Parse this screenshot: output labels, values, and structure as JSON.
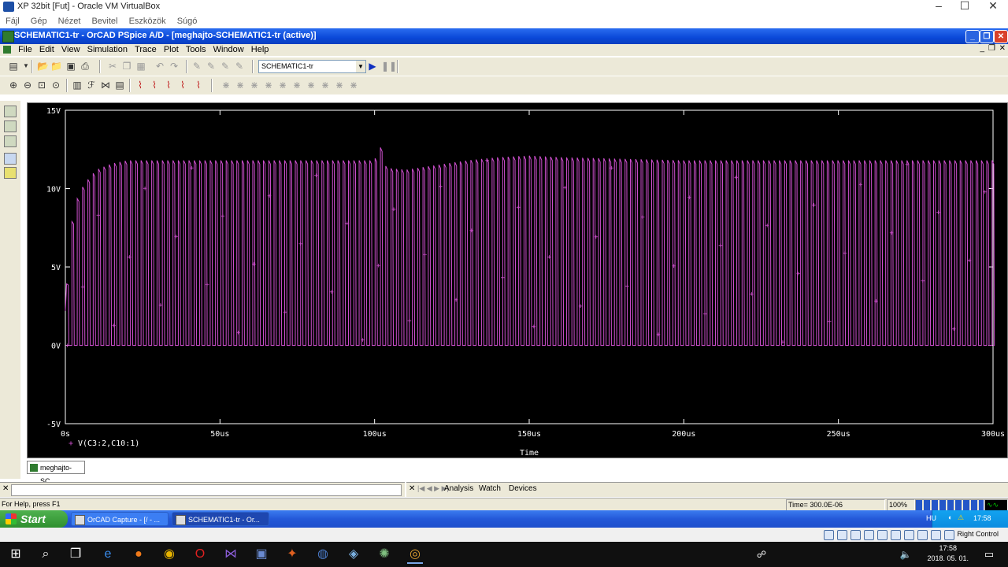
{
  "vbox": {
    "title": "XP 32bit [Fut] - Oracle VM VirtualBox",
    "menu": [
      "Fájl",
      "Gép",
      "Nézet",
      "Bevitel",
      "Eszközök",
      "Súgó"
    ],
    "minimize": "–",
    "maximize": "☐",
    "close": "✕",
    "status_right": "Right Control"
  },
  "app": {
    "title": "SCHEMATIC1-tr - OrCAD PSpice A/D - [meghajto-SCHEMATIC1-tr (active)]",
    "menu": [
      "File",
      "Edit",
      "View",
      "Simulation",
      "Trace",
      "Plot",
      "Tools",
      "Window",
      "Help"
    ],
    "sim_profile": "SCHEMATIC1-tr",
    "doc_tab": "meghajto-SC..."
  },
  "toolbar_icons": {
    "row1": [
      "new-icon",
      "open-icon",
      "open-folder-icon",
      "save-icon",
      "print-icon",
      "cut-icon",
      "copy-icon",
      "paste-icon",
      "undo-icon",
      "redo-icon",
      "marker-icon",
      "marker-current-icon",
      "marker-power-icon",
      "marker-diff-icon",
      "run-icon",
      "pause-icon"
    ],
    "row2": [
      "zoom-in-icon",
      "zoom-out-icon",
      "zoom-area-icon",
      "zoom-fit-icon",
      "log-x-icon",
      "fourier-icon",
      "performance-icon",
      "log-y-icon",
      "add-trace-icon",
      "eval-measure-icon",
      "toggle-cursor-icon",
      "cursor-peak-icon",
      "cursor-trough-icon",
      "cursor-slope-icon"
    ]
  },
  "chart_data": {
    "type": "line",
    "title": "",
    "xlabel": "Time",
    "ylabel": "",
    "x_ticks": [
      "0s",
      "50us",
      "100us",
      "150us",
      "200us",
      "250us",
      "300us"
    ],
    "y_ticks": [
      "15V",
      "10V",
      "5V",
      "0V",
      "-5V"
    ],
    "xlim_us": [
      0,
      300
    ],
    "ylim_v": [
      -5,
      15
    ],
    "grid": false,
    "background": "#000000",
    "series": [
      {
        "name": "V(C3:2,C10:1)",
        "color": "#d050d0",
        "marker": "+",
        "description": "PWM-like switching waveform, period ≈ 1.7 us, low level 0 V",
        "envelope_x_us": [
          0,
          1,
          3,
          6,
          10,
          15,
          20,
          30,
          40,
          60,
          80,
          100,
          101.5,
          103,
          105,
          110,
          120,
          130,
          140,
          150,
          160,
          180,
          200,
          220,
          250,
          280,
          300
        ],
        "envelope_y_v": [
          2.2,
          6.5,
          9.0,
          10.3,
          11.2,
          11.6,
          11.8,
          11.8,
          11.8,
          11.8,
          11.8,
          11.8,
          13.0,
          11.5,
          11.3,
          11.2,
          11.5,
          11.8,
          12.0,
          12.1,
          12.0,
          11.9,
          11.8,
          11.8,
          11.8,
          11.8,
          11.8
        ]
      }
    ]
  },
  "panes": {
    "tabs": [
      "Analysis",
      "Watch",
      "Devices"
    ]
  },
  "status": {
    "help": "For Help, press F1",
    "time": "Time= 300.0E-06",
    "zoom": "100%"
  },
  "xp_taskbar": {
    "start": "Start",
    "tasks": [
      "OrCAD Capture - [/ - ...",
      "SCHEMATIC1-tr - Or..."
    ],
    "lang": "HU",
    "clock": "17:58"
  },
  "win10": {
    "clock_time": "17:58",
    "clock_date": "2018. 05. 01."
  }
}
